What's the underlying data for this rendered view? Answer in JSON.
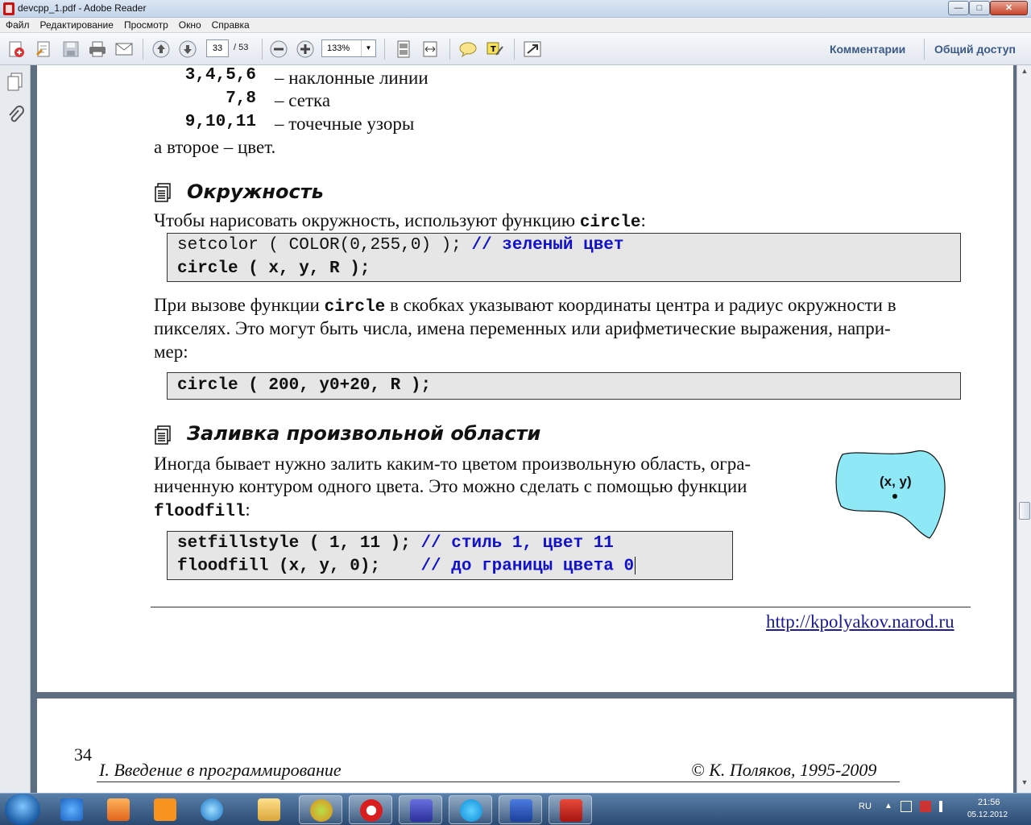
{
  "window": {
    "title": "devcpp_1.pdf - Adobe Reader",
    "minimize": "—",
    "maximize": "□",
    "close": "✕"
  },
  "menu": [
    "Файл",
    "Редактирование",
    "Просмотр",
    "Окно",
    "Справка"
  ],
  "toolbar": {
    "current_page": "33",
    "total_pages": "/ 53",
    "zoom": "133%",
    "comments_label": "Комментарии",
    "share_label": "Общий доступ"
  },
  "document": {
    "hatch_rows": [
      {
        "codes": "3,4,5,6",
        "desc": "– наклонные линии"
      },
      {
        "codes": "7,8",
        "desc": "– сетка"
      },
      {
        "codes": "9,10,11",
        "desc": "– точечные узоры"
      }
    ],
    "second_param_text": "а второе – цвет.",
    "circle_section": {
      "heading": "Окружность",
      "intro_text": "Чтобы нарисовать окружность, используют функцию ",
      "intro_func": "circle",
      "intro_end": ":",
      "code_line1": "setcolor ( COLOR(0,255,0) ); ",
      "code_line1_comment": "// зеленый цвет",
      "code_line2": "circle ( x, y, R );",
      "para_line1_a": "При вызове функции ",
      "para_line1_func": "circle",
      "para_line1_b": " в скобках указывают координаты центра и радиус окружности в",
      "para_line2": "пикселях. Это могут быть числа, имена переменных или арифметические выражения, напри-",
      "para_line3": "мер:",
      "example_code": "circle ( 200, y0+20, R );"
    },
    "fill_section": {
      "heading": "Заливка произвольной области",
      "para_line1": "Иногда бывает нужно залить каким-то цветом произвольную область, огра-",
      "para_line2": "ниченную контуром одного цвета. Это можно сделать с помощью функции",
      "para_func": "floodfill",
      "para_end": ":",
      "code_line1": "setfillstyle ( 1, 11 ); ",
      "code_line1_comment": "// стиль 1, цвет 11",
      "code_line2": "floodfill (x, y, 0);    ",
      "code_line2_comment": "// до границы цвета 0",
      "figure_label": "(x, y)"
    },
    "site_link": "http://kpolyakov.narod.ru",
    "page_number": "34",
    "footer_left": "I. Введение в программирование",
    "footer_right": "© К. Поляков, 1995-2009"
  },
  "taskbar": {
    "language": "RU",
    "time": "21:56",
    "date": "05.12.2012"
  },
  "colors": {
    "code_comment": "#1111cc",
    "code_bg": "#e6e6e6",
    "blob_fill": "#8ee8f5",
    "link": "#1a1a9a"
  }
}
